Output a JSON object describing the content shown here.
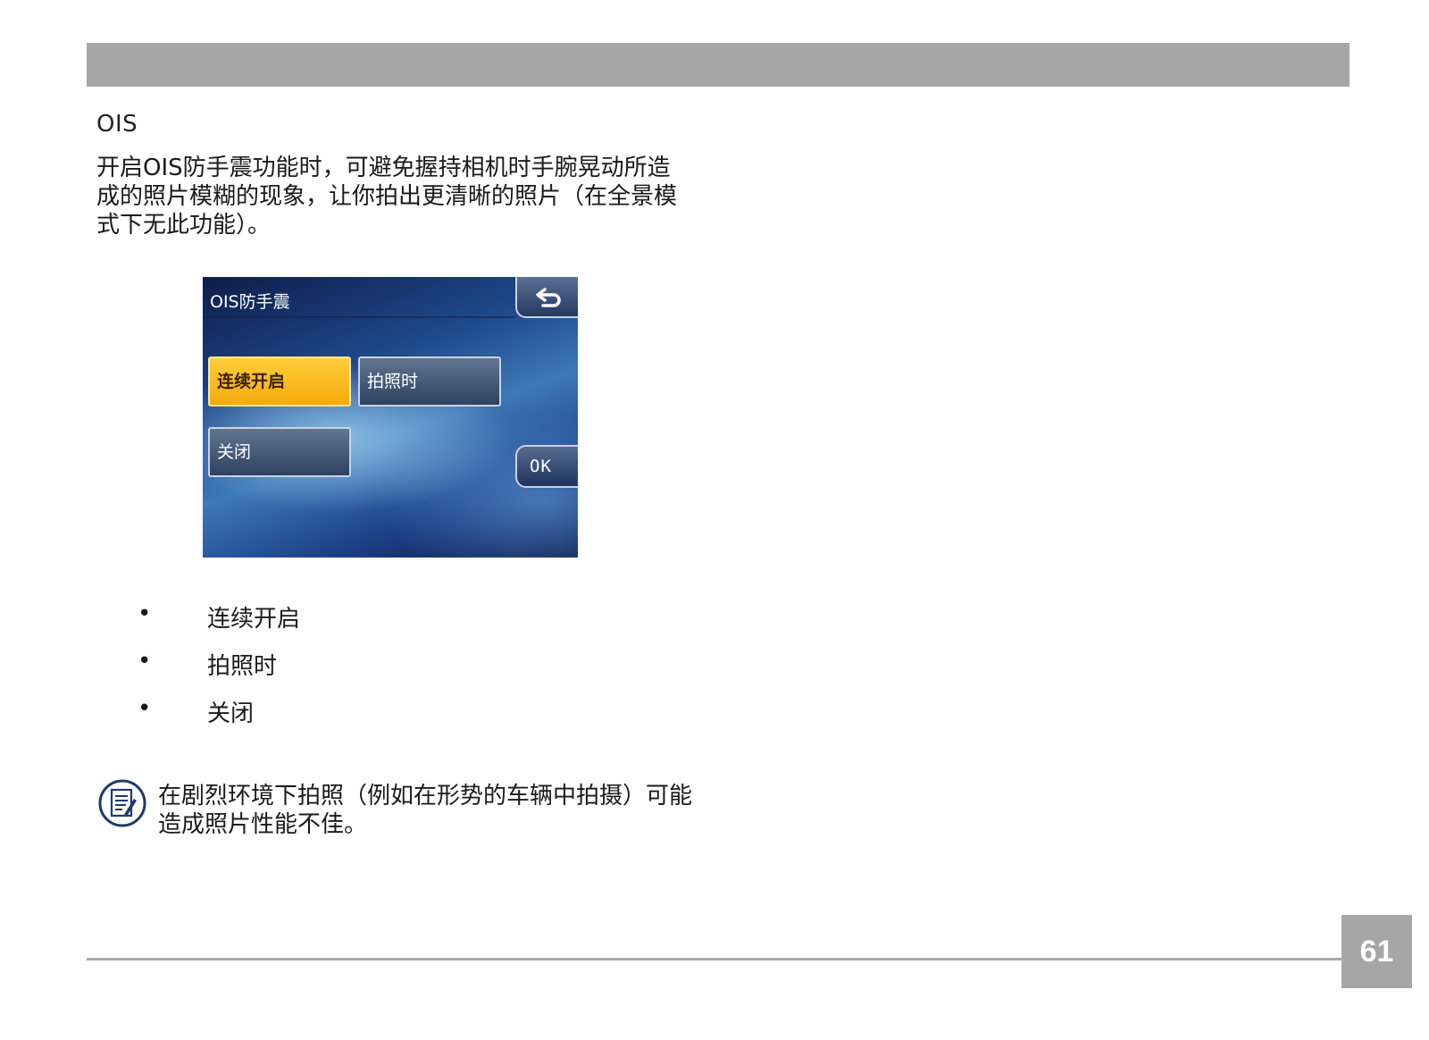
{
  "section": {
    "title": "OIS",
    "intro": "开启OIS防手震功能时，可避免握持相机时手腕晃动所造成的照片模糊的现象，让你拍出更清晰的照片（在全景模式下无此功能）。"
  },
  "screen": {
    "title": "OIS防手震",
    "options": [
      "连续开启",
      "拍照时",
      "关闭"
    ],
    "selected_index": 0,
    "ok_label": "OK",
    "back_icon": "return-arrow-icon"
  },
  "bullets": [
    {
      "marker": "•",
      "text": "连续开启"
    },
    {
      "marker": "•",
      "text": "拍照时"
    },
    {
      "marker": "•",
      "text": "关闭"
    }
  ],
  "note": {
    "icon": "note-icon",
    "text": "在剧烈环境下拍照（例如在形势的车辆中拍摄）可能造成照片性能不佳。"
  },
  "footer": {
    "page_number": "61"
  },
  "colors": {
    "bar_gray": "#a6a6a6",
    "selected_option": "#f7a90c",
    "note_icon": "#1e3a6a"
  }
}
